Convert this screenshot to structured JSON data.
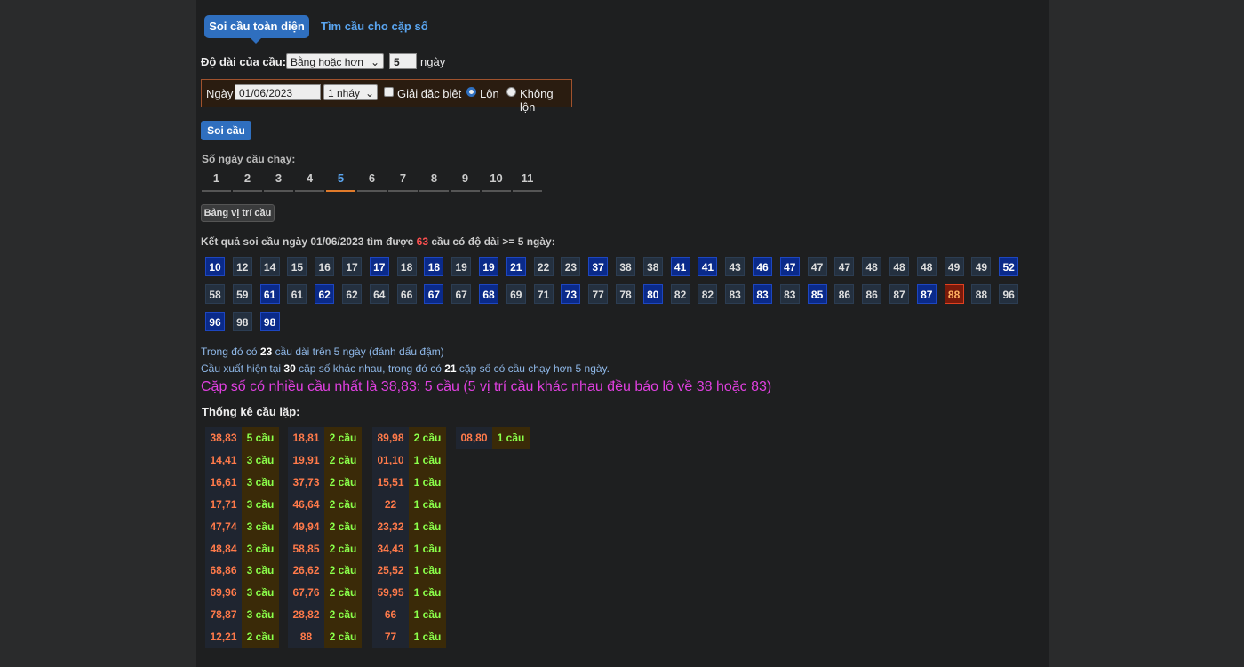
{
  "tabs": {
    "active": "Soi cầu toàn diện",
    "other": "Tìm cầu cho cặp số"
  },
  "form": {
    "length_label": "Độ dài của cầu:",
    "length_select": "Bằng hoặc hơn",
    "length_value": "5",
    "length_unit": "ngày",
    "date_label": "Ngày",
    "date_value": "01/06/2023",
    "jump_select": "1 nháy",
    "special_label": "Giải đặc biệt",
    "radio_lon": "Lộn",
    "radio_khong_lon": "Không lộn",
    "submit": "Soi cầu"
  },
  "days": {
    "label": "Số ngày cầu chạy:",
    "items": [
      "1",
      "2",
      "3",
      "4",
      "5",
      "6",
      "7",
      "8",
      "9",
      "10",
      "11"
    ],
    "active_index": 4
  },
  "position_table_button": "Bảng vị trí cầu",
  "result": {
    "prefix": "Kết quả soi cầu ngày 01/06/2023 tìm được ",
    "count": "63",
    "suffix": " cầu có độ dài >= 5 ngày:"
  },
  "numbers": [
    {
      "v": "10",
      "s": "bold"
    },
    {
      "v": "12",
      "s": "plain"
    },
    {
      "v": "14",
      "s": "plain"
    },
    {
      "v": "15",
      "s": "plain"
    },
    {
      "v": "16",
      "s": "plain"
    },
    {
      "v": "17",
      "s": "plain"
    },
    {
      "v": "17",
      "s": "bold"
    },
    {
      "v": "18",
      "s": "plain"
    },
    {
      "v": "18",
      "s": "bold"
    },
    {
      "v": "19",
      "s": "plain"
    },
    {
      "v": "19",
      "s": "bold"
    },
    {
      "v": "21",
      "s": "bold"
    },
    {
      "v": "22",
      "s": "plain"
    },
    {
      "v": "23",
      "s": "plain"
    },
    {
      "v": "37",
      "s": "bold"
    },
    {
      "v": "38",
      "s": "plain"
    },
    {
      "v": "38",
      "s": "plain"
    },
    {
      "v": "41",
      "s": "bold"
    },
    {
      "v": "41",
      "s": "bold"
    },
    {
      "v": "43",
      "s": "plain"
    },
    {
      "v": "46",
      "s": "bold"
    },
    {
      "v": "47",
      "s": "bold"
    },
    {
      "v": "47",
      "s": "plain"
    },
    {
      "v": "47",
      "s": "plain"
    },
    {
      "v": "48",
      "s": "plain"
    },
    {
      "v": "48",
      "s": "plain"
    },
    {
      "v": "48",
      "s": "plain"
    },
    {
      "v": "49",
      "s": "plain"
    },
    {
      "v": "49",
      "s": "plain"
    },
    {
      "v": "52",
      "s": "bold"
    },
    {
      "v": "58",
      "s": "plain"
    },
    {
      "v": "59",
      "s": "plain"
    },
    {
      "v": "61",
      "s": "bold"
    },
    {
      "v": "61",
      "s": "plain"
    },
    {
      "v": "62",
      "s": "bold"
    },
    {
      "v": "62",
      "s": "plain"
    },
    {
      "v": "64",
      "s": "plain"
    },
    {
      "v": "66",
      "s": "plain"
    },
    {
      "v": "67",
      "s": "bold"
    },
    {
      "v": "67",
      "s": "plain"
    },
    {
      "v": "68",
      "s": "bold"
    },
    {
      "v": "69",
      "s": "plain"
    },
    {
      "v": "71",
      "s": "plain"
    },
    {
      "v": "73",
      "s": "bold"
    },
    {
      "v": "77",
      "s": "plain"
    },
    {
      "v": "78",
      "s": "plain"
    },
    {
      "v": "80",
      "s": "bold"
    },
    {
      "v": "82",
      "s": "plain"
    },
    {
      "v": "82",
      "s": "plain"
    },
    {
      "v": "83",
      "s": "plain"
    },
    {
      "v": "83",
      "s": "bold"
    },
    {
      "v": "83",
      "s": "plain"
    },
    {
      "v": "85",
      "s": "bold"
    },
    {
      "v": "86",
      "s": "plain"
    },
    {
      "v": "86",
      "s": "plain"
    },
    {
      "v": "87",
      "s": "plain"
    },
    {
      "v": "87",
      "s": "bold"
    },
    {
      "v": "88",
      "s": "hot"
    },
    {
      "v": "88",
      "s": "plain"
    },
    {
      "v": "96",
      "s": "plain"
    },
    {
      "v": "96",
      "s": "bold"
    },
    {
      "v": "98",
      "s": "plain"
    },
    {
      "v": "98",
      "s": "bold"
    }
  ],
  "info": {
    "line1_a": "Trong đó có ",
    "line1_b": "23",
    "line1_c": " cầu dài trên 5 ngày (đánh dấu đậm)",
    "line2_a": "Cầu xuất hiện tại ",
    "line2_b": "30",
    "line2_c": " cặp số khác nhau, trong đó có ",
    "line2_d": "21",
    "line2_e": " cặp số có cầu chạy hơn 5 ngày.",
    "highlight": "Cặp số có nhiều cầu nhất là 38,83: 5 cầu (5 vị trí cầu khác nhau đều báo lô về 38 hoặc 83)"
  },
  "stats_title": "Thống kê cầu lặp:",
  "stats": [
    [
      [
        "38,83",
        "5 cầu"
      ],
      [
        "14,41",
        "3 cầu"
      ],
      [
        "16,61",
        "3 cầu"
      ],
      [
        "17,71",
        "3 cầu"
      ],
      [
        "47,74",
        "3 cầu"
      ],
      [
        "48,84",
        "3 cầu"
      ],
      [
        "68,86",
        "3 cầu"
      ],
      [
        "69,96",
        "3 cầu"
      ],
      [
        "78,87",
        "3 cầu"
      ],
      [
        "12,21",
        "2 cầu"
      ]
    ],
    [
      [
        "18,81",
        "2 cầu"
      ],
      [
        "19,91",
        "2 cầu"
      ],
      [
        "37,73",
        "2 cầu"
      ],
      [
        "46,64",
        "2 cầu"
      ],
      [
        "49,94",
        "2 cầu"
      ],
      [
        "58,85",
        "2 cầu"
      ],
      [
        "26,62",
        "2 cầu"
      ],
      [
        "67,76",
        "2 cầu"
      ],
      [
        "28,82",
        "2 cầu"
      ],
      [
        "88",
        "2 cầu"
      ]
    ],
    [
      [
        "89,98",
        "2 cầu"
      ],
      [
        "01,10",
        "1 cầu"
      ],
      [
        "15,51",
        "1 cầu"
      ],
      [
        "22",
        "1 cầu"
      ],
      [
        "23,32",
        "1 cầu"
      ],
      [
        "34,43",
        "1 cầu"
      ],
      [
        "25,52",
        "1 cầu"
      ],
      [
        "59,95",
        "1 cầu"
      ],
      [
        "66",
        "1 cầu"
      ],
      [
        "77",
        "1 cầu"
      ]
    ],
    [
      [
        "08,80",
        "1 cầu"
      ]
    ]
  ]
}
